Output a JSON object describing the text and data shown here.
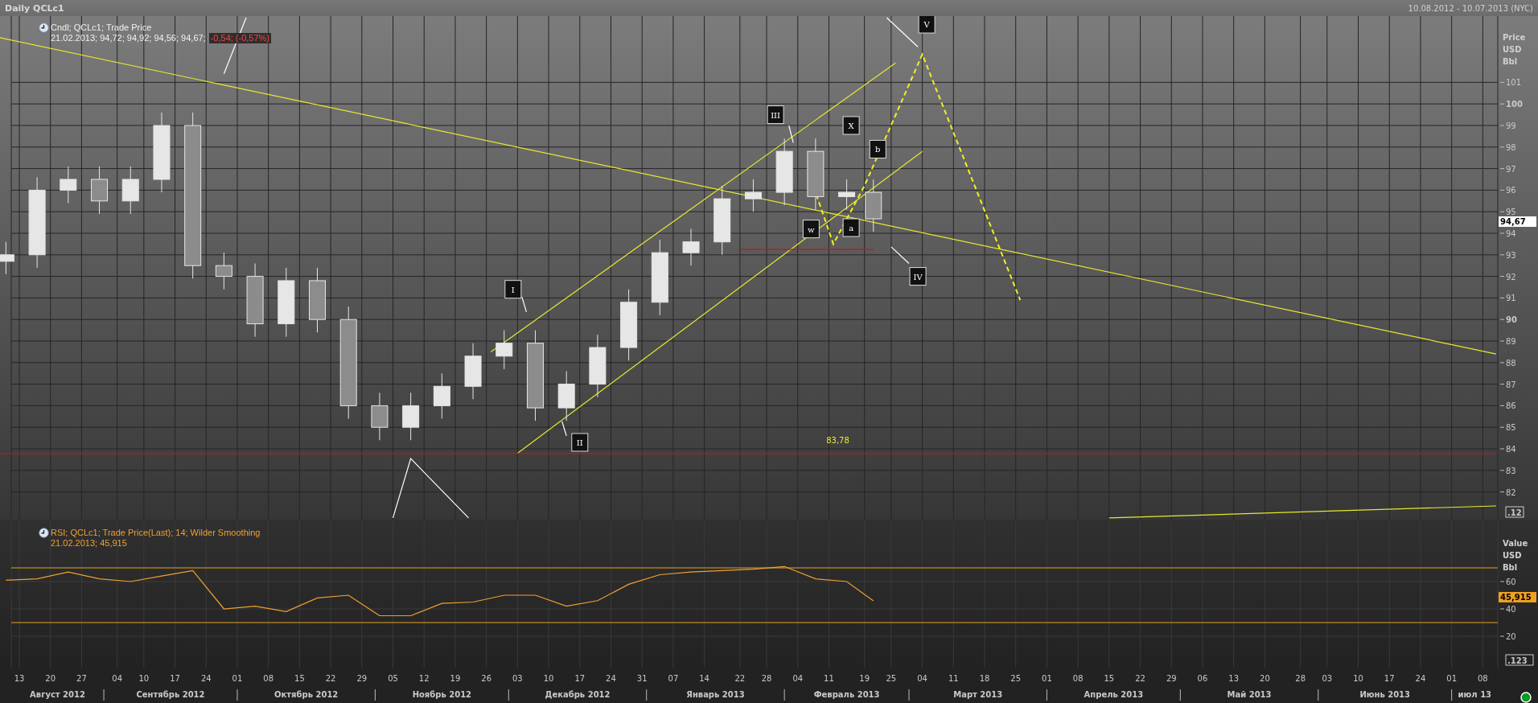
{
  "window": {
    "title": "Daily QCLc1",
    "range": "10.08.2012 - 10.07.2013 (NYC)"
  },
  "price_panel": {
    "legend": {
      "name": "Cndl; QCLc1; Trade Price",
      "values": "21.02.2013; 94,72; 94,92; 94,56; 94,67;",
      "change": "-0,54; (-0,57%)"
    },
    "axis_units": [
      "Price",
      "USD",
      "Bbl"
    ],
    "axis_ticks": [
      {
        "label": "101",
        "major": false
      },
      {
        "label": "100",
        "major": true
      },
      {
        "label": "99",
        "major": false
      },
      {
        "label": "98",
        "major": false
      },
      {
        "label": "97",
        "major": false
      },
      {
        "label": "96",
        "major": false
      },
      {
        "label": "95",
        "major": false
      },
      {
        "label": "94",
        "major": false
      },
      {
        "label": "93",
        "major": false
      },
      {
        "label": "92",
        "major": false
      },
      {
        "label": "91",
        "major": false
      },
      {
        "label": "90",
        "major": true
      },
      {
        "label": "89",
        "major": false
      },
      {
        "label": "88",
        "major": false
      },
      {
        "label": "87",
        "major": false
      },
      {
        "label": "86",
        "major": false
      },
      {
        "label": "85",
        "major": false
      },
      {
        "label": "84",
        "major": false
      },
      {
        "label": "83",
        "major": false
      },
      {
        "label": "82",
        "major": false
      }
    ],
    "last_value": "94,67",
    "range_marker": ".12",
    "level_label": "83,78",
    "wave_labels": [
      "I",
      "II",
      "III",
      "IV",
      "V",
      "X",
      "b",
      "a",
      "w"
    ]
  },
  "rsi_panel": {
    "legend": {
      "name": "RSI; QCLc1; Trade Price(Last);  14; Wilder Smoothing",
      "values": "21.02.2013; 45,915"
    },
    "axis_units": [
      "Value",
      "USD",
      "Bbl"
    ],
    "axis_ticks": [
      {
        "label": "60",
        "major": false
      },
      {
        "label": "40",
        "major": false
      },
      {
        "label": "20",
        "major": false
      }
    ],
    "last_value": "45,915",
    "range_marker": ".123"
  },
  "time_axis": {
    "ticks": [
      "13",
      "20",
      "27",
      "04",
      "10",
      "17",
      "24",
      "01",
      "08",
      "15",
      "22",
      "29",
      "05",
      "12",
      "19",
      "26",
      "03",
      "10",
      "17",
      "24",
      "31",
      "07",
      "14",
      "22",
      "28",
      "04",
      "11",
      "19",
      "25",
      "04",
      "11",
      "18",
      "25",
      "01",
      "08",
      "15",
      "22",
      "29",
      "06",
      "13",
      "20",
      "28",
      "03",
      "10",
      "17",
      "24",
      "01",
      "08"
    ],
    "months": [
      "Август 2012",
      "Сентябрь 2012",
      "Октябрь 2012",
      "Ноябрь 2012",
      "Декабрь 2012",
      "Январь 2013",
      "Февраль 2013",
      "Март 2013",
      "Апрель 2013",
      "Май 2013",
      "Июнь 2013",
      "июл 13"
    ]
  }
}
